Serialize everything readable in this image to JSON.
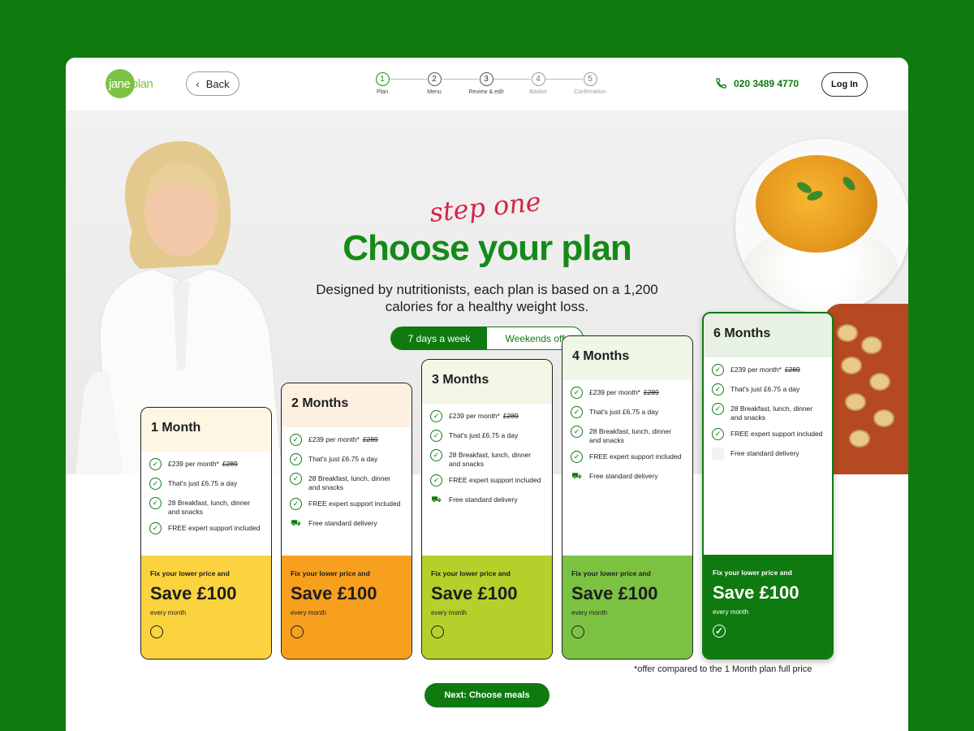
{
  "header": {
    "logo_part1": "jane",
    "logo_part2": "plan",
    "back_label": "Back",
    "phone": "020 3489 4770",
    "login_label": "Log In",
    "steps": [
      {
        "num": "1",
        "label": "Plan",
        "state": "active"
      },
      {
        "num": "2",
        "label": "Menu",
        "state": "normal"
      },
      {
        "num": "3",
        "label": "Review & edit",
        "state": "normal"
      },
      {
        "num": "4",
        "label": "Basket",
        "state": "muted"
      },
      {
        "num": "5",
        "label": "Confirmation",
        "state": "muted"
      }
    ]
  },
  "hero": {
    "script_text": "step one",
    "title": "Choose your plan",
    "subtitle": "Designed by nutritionists, each plan is based on a 1,200 calories for a healthy weight loss.",
    "toggle": {
      "option_on": "7 days a week",
      "option_off": "Weekends off"
    }
  },
  "plans": [
    {
      "name": "1 Month",
      "head_color": "#fdf6e3",
      "offer_color": "#fad33f",
      "selected": false,
      "features": [
        {
          "icon": "check",
          "text": "£239 per month*",
          "strike": "£289"
        },
        {
          "icon": "check",
          "text": "That's just £6.75 a day"
        },
        {
          "icon": "check",
          "text": "28 Breakfast, lunch, dinner and snacks"
        },
        {
          "icon": "check",
          "text": "FREE expert support included"
        }
      ],
      "offer_lead": "Fix your lower price and",
      "offer_save": "Save £100",
      "offer_sub": "every month"
    },
    {
      "name": "2 Months",
      "head_color": "#fdf0e0",
      "offer_color": "#f7a01e",
      "selected": false,
      "features": [
        {
          "icon": "check",
          "text": "£239 per month*",
          "strike": "£289"
        },
        {
          "icon": "check",
          "text": "That's just £6.75 a day"
        },
        {
          "icon": "check",
          "text": "28 Breakfast, lunch, dinner and snacks"
        },
        {
          "icon": "check",
          "text": "FREE expert support included"
        },
        {
          "icon": "truck",
          "text": "Free standard delivery"
        }
      ],
      "offer_lead": "Fix your lower price and",
      "offer_save": "Save £100",
      "offer_sub": "every month"
    },
    {
      "name": "3 Months",
      "head_color": "#f4f7e6",
      "offer_color": "#b7cf2a",
      "selected": false,
      "features": [
        {
          "icon": "check",
          "text": "£239 per month*",
          "strike": "£289"
        },
        {
          "icon": "check",
          "text": "That's just £6.75 a day"
        },
        {
          "icon": "check",
          "text": "28 Breakfast, lunch, dinner and snacks"
        },
        {
          "icon": "check",
          "text": "FREE expert support included"
        },
        {
          "icon": "truck",
          "text": "Free standard delivery"
        }
      ],
      "offer_lead": "Fix your lower price and",
      "offer_save": "Save £100",
      "offer_sub": "every month"
    },
    {
      "name": "4 Months",
      "head_color": "#eef6e6",
      "offer_color": "#7cc242",
      "selected": false,
      "features": [
        {
          "icon": "check",
          "text": "£239 per month*",
          "strike": "£289"
        },
        {
          "icon": "check",
          "text": "That's just £6.75 a day"
        },
        {
          "icon": "check",
          "text": "28 Breakfast, lunch, dinner and snacks"
        },
        {
          "icon": "check",
          "text": "FREE expert support included"
        },
        {
          "icon": "truck",
          "text": "Free standard delivery"
        }
      ],
      "offer_lead": "Fix your lower price and",
      "offer_save": "Save £100",
      "offer_sub": "every month"
    },
    {
      "name": "6 Months",
      "head_color": "#e7f1e4",
      "offer_color": "#0f7a10",
      "selected": true,
      "features": [
        {
          "icon": "check",
          "text": "£239 per month*",
          "strike": "£289"
        },
        {
          "icon": "check",
          "text": "That's just £6.75 a day"
        },
        {
          "icon": "check",
          "text": "28 Breakfast, lunch, dinner and snacks"
        },
        {
          "icon": "check",
          "text": "FREE expert support included"
        },
        {
          "icon": "blank",
          "text": "Free standard delivery"
        }
      ],
      "offer_lead": "Fix your lower price and",
      "offer_save": "Save £100",
      "offer_sub": "every month"
    }
  ],
  "footnote": "*offer compared to the 1 Month plan full price",
  "next_label": "Next: Choose meals",
  "colors": {
    "brand_green": "#0f7a10",
    "logo_green": "#7cc242",
    "script_red": "#d72346"
  }
}
